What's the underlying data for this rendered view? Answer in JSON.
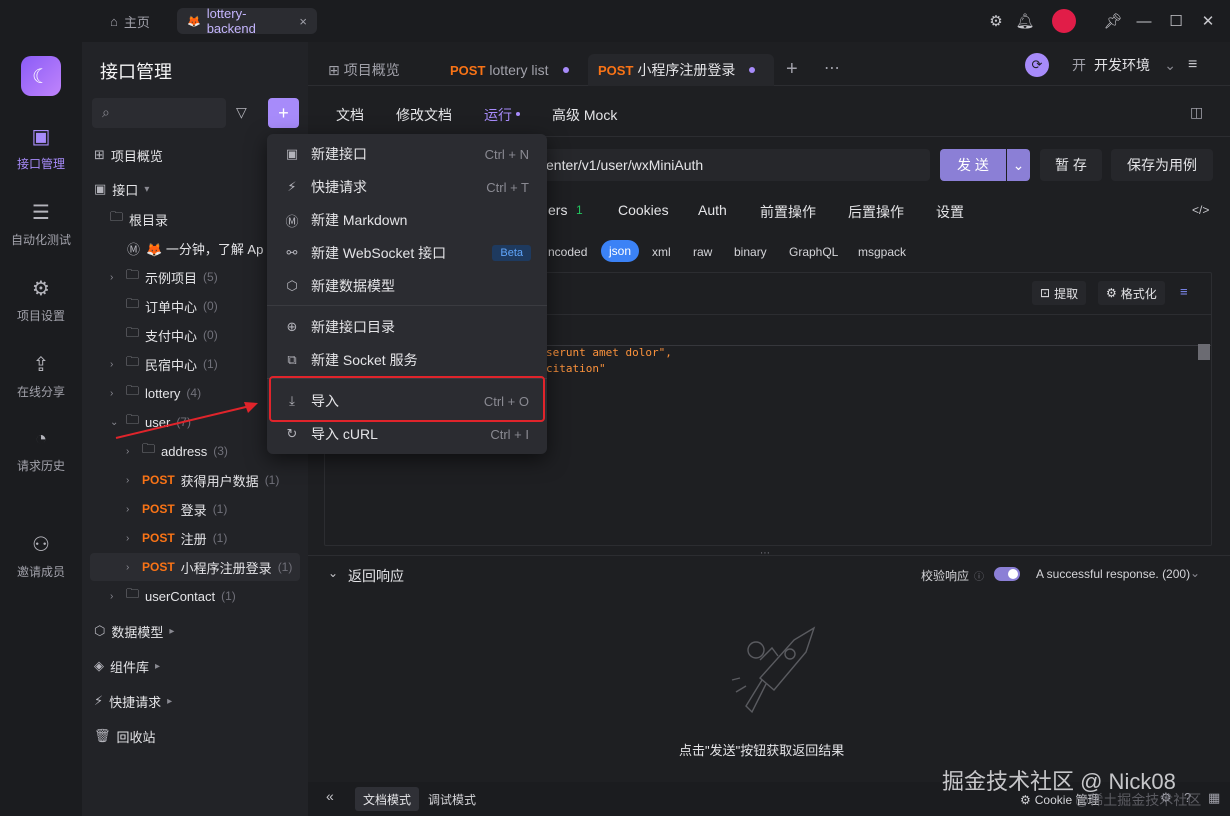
{
  "titlebar": {
    "home_label": "主页",
    "project_tab": "lottery-backend"
  },
  "rail": {
    "items": [
      {
        "label": "接口管理",
        "icon": "api-icon"
      },
      {
        "label": "自动化测试",
        "icon": "automation-icon"
      },
      {
        "label": "项目设置",
        "icon": "settings-icon"
      },
      {
        "label": "在线分享",
        "icon": "share-icon"
      },
      {
        "label": "请求历史",
        "icon": "history-icon"
      },
      {
        "label": "邀请成员",
        "icon": "invite-icon"
      }
    ]
  },
  "tree": {
    "title": "接口管理",
    "overview": "项目概览",
    "interface": "接口",
    "root": "根目录",
    "doc_item": "🦊 一分钟，了解 Ap",
    "folders": [
      {
        "name": "示例项目",
        "count": "(5)"
      },
      {
        "name": "订单中心",
        "count": "(0)"
      },
      {
        "name": "支付中心",
        "count": "(0)"
      },
      {
        "name": "民宿中心",
        "count": "(1)"
      },
      {
        "name": "lottery",
        "count": "(4)"
      },
      {
        "name": "user",
        "count": "(7)"
      }
    ],
    "user_children": [
      {
        "name": "address",
        "count": "(3)"
      },
      {
        "method": "POST",
        "name": "获得用户数据",
        "count": "(1)"
      },
      {
        "method": "POST",
        "name": "登录",
        "count": "(1)"
      },
      {
        "method": "POST",
        "name": "注册",
        "count": "(1)"
      },
      {
        "method": "POST",
        "name": "小程序注册登录",
        "count": "(1)"
      }
    ],
    "user_contact": {
      "name": "userContact",
      "count": "(1)"
    },
    "bottom": [
      "数据模型",
      "组件库",
      "快捷请求",
      "回收站"
    ]
  },
  "tabs": [
    {
      "label": "项目概览"
    },
    {
      "method": "POST",
      "label": "lottery list"
    },
    {
      "method": "POST",
      "label": "小程序注册登录"
    }
  ],
  "env": "开发环境",
  "subnav": [
    "文档",
    "修改文档",
    "运行",
    "高级 Mock"
  ],
  "url_text": "enter/v1/user/wxMiniAuth",
  "buttons": {
    "send": "发 送",
    "save": "暂 存",
    "save_as_case": "保存为用例"
  },
  "req_tabs": [
    "ers",
    "1",
    "Cookies",
    "Auth",
    "前置操作",
    "后置操作",
    "设置"
  ],
  "body_types": [
    "ncoded",
    "json",
    "xml",
    "raw",
    "binary",
    "GraphQL",
    "msgpack"
  ],
  "editor_tools": {
    "extract": "提取",
    "format": "格式化"
  },
  "code_lines": [
    "serunt amet dolor\",",
    "citation\""
  ],
  "menu": {
    "items": [
      {
        "icon": "api-new-icon",
        "label": "新建接口",
        "shortcut": "Ctrl + N"
      },
      {
        "icon": "lightning-icon",
        "label": "快捷请求",
        "shortcut": "Ctrl + T"
      },
      {
        "icon": "markdown-icon",
        "label": "新建 Markdown",
        "shortcut": ""
      },
      {
        "icon": "websocket-icon",
        "label": "新建 WebSocket 接口",
        "badge": "Beta"
      },
      {
        "icon": "cube-icon",
        "label": "新建数据模型",
        "shortcut": ""
      },
      {
        "icon": "folder-plus-icon",
        "label": "新建接口目录",
        "shortcut": ""
      },
      {
        "icon": "socket-icon",
        "label": "新建 Socket 服务",
        "shortcut": ""
      },
      {
        "icon": "import-icon",
        "label": "导入",
        "shortcut": "Ctrl + O"
      },
      {
        "icon": "curl-icon",
        "label": "导入 cURL",
        "shortcut": "Ctrl + I"
      }
    ]
  },
  "response": {
    "title": "返回响应",
    "validate": "校验响应",
    "status": "A successful response. (200)",
    "hint": "点击\"发送\"按钮获取返回结果"
  },
  "statusbar": {
    "doc_mode": "文档模式",
    "debug_mode": "调试模式",
    "cookie": "Cookie 管理"
  },
  "watermark": "掘金技术社区 @ Nick08",
  "watermark_small": "@稀土掘金技术社区"
}
